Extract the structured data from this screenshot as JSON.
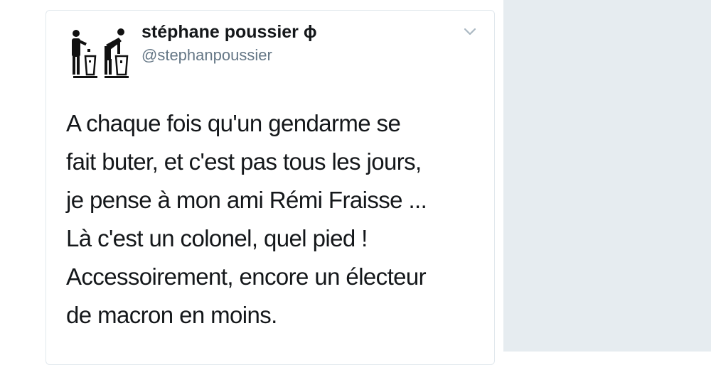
{
  "tweet": {
    "author_name": "stéphane poussier ɸ",
    "author_handle": "@stephanpoussier",
    "avatar_icon": "trash-bin-people-icon",
    "menu_icon": "chevron-down-icon",
    "lines": [
      "A chaque fois qu'un gendarme se",
      "fait buter, et c'est pas tous les jours,",
      "je pense à mon ami Rémi Fraisse ...",
      "Là c'est un colonel, quel pied !",
      "Accessoirement, encore un électeur",
      "de macron en moins."
    ]
  },
  "colors": {
    "text": "#14171a",
    "secondary": "#657786",
    "side_panel": "#e6ecf0",
    "border": "#e1e8ed"
  }
}
